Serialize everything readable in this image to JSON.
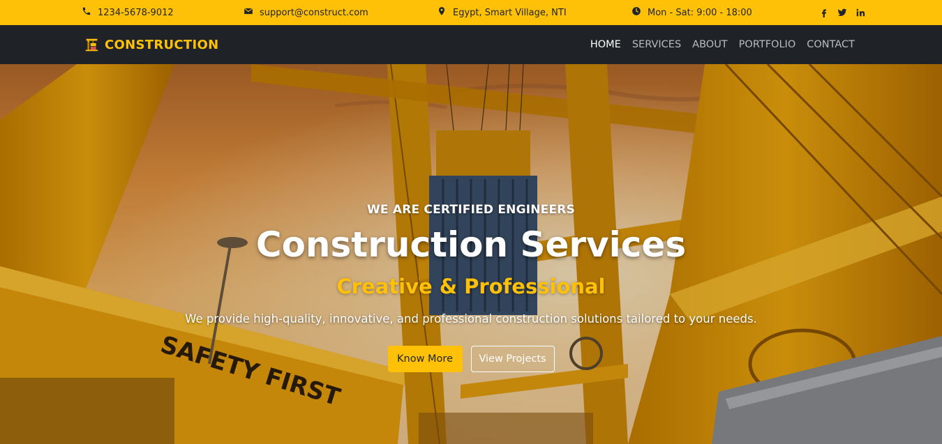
{
  "topbar": {
    "phone": "1234-5678-9012",
    "email": "support@construct.com",
    "location": "Egypt, Smart Village, NTI",
    "hours": "Mon - Sat: 9:00 - 18:00",
    "social": [
      "facebook-icon",
      "twitter-icon",
      "linkedin-icon"
    ],
    "background": "#ffc107"
  },
  "navbar": {
    "brand": "CONSTRUCTION",
    "brand_color": "#ffc107",
    "background": "#1f2227",
    "links": [
      {
        "label": "HOME",
        "active": true
      },
      {
        "label": "SERVICES",
        "active": false
      },
      {
        "label": "ABOUT",
        "active": false
      },
      {
        "label": "PORTFOLIO",
        "active": false
      },
      {
        "label": "CONTACT",
        "active": false
      }
    ]
  },
  "hero": {
    "eyebrow": "WE ARE CERTIFIED ENGINEERS",
    "headline": "Construction Services",
    "tagline": "Creative & Professional",
    "description": "We provide high-quality, innovative, and professional construction solutions tailored to your needs.",
    "primary_button": "Know More",
    "secondary_button": "View Projects",
    "background_image": "yellow port cranes at sunset",
    "crane_sign": "SAFETY FIRST"
  }
}
